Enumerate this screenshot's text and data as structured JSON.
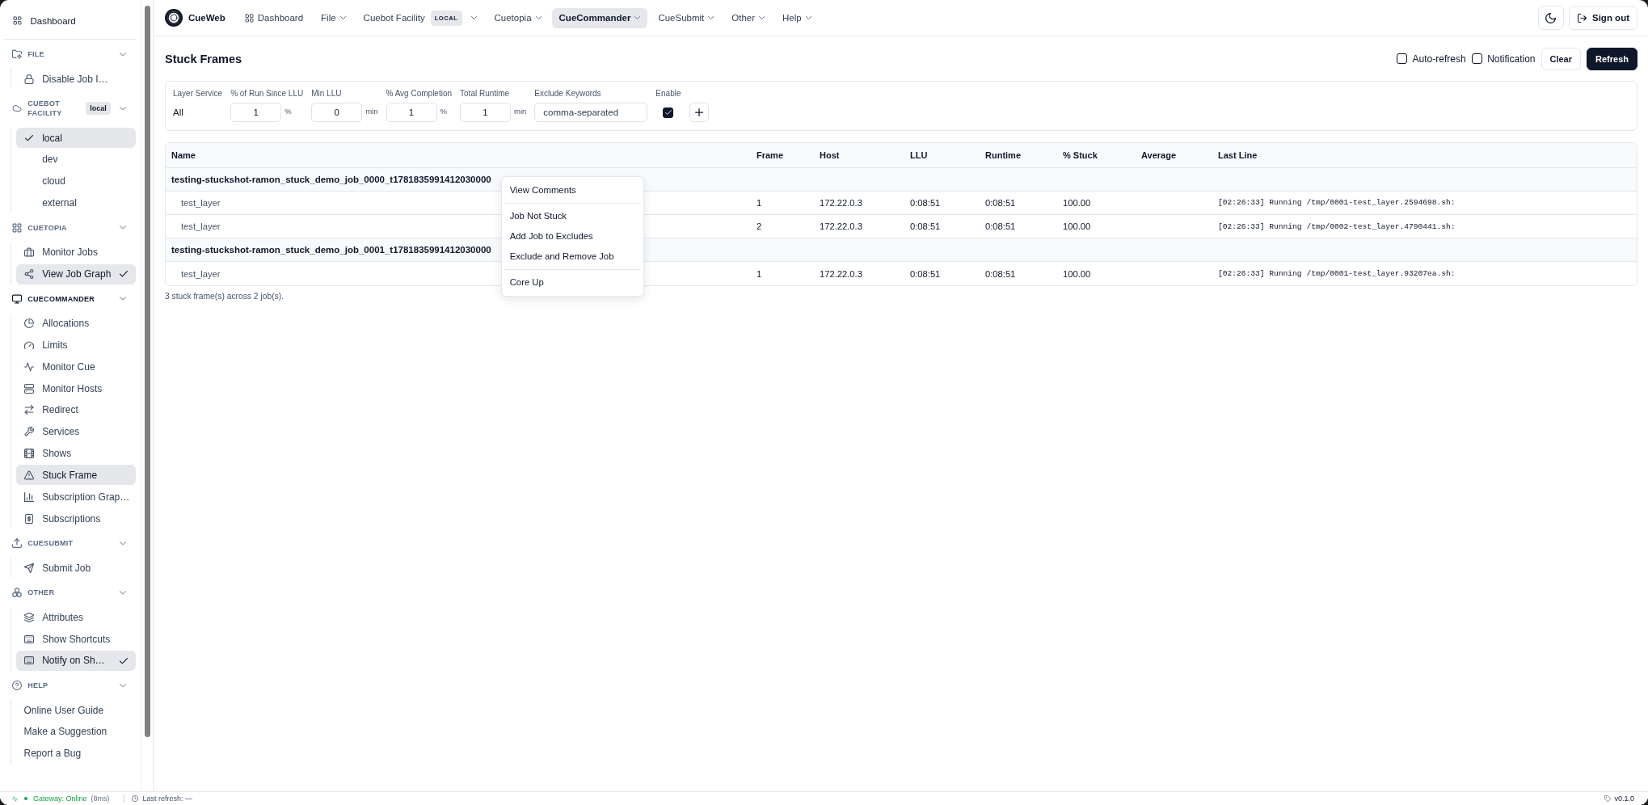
{
  "topbar": {
    "logo": "CueWeb",
    "nav": [
      {
        "label": "Dashboard",
        "kind": "link",
        "selected": false
      },
      {
        "label": "File",
        "kind": "menu",
        "selected": false
      },
      {
        "label": "Cuebot Facility",
        "kind": "menu",
        "badge": "LOCAL",
        "selected": false
      },
      {
        "label": "Cuetopia",
        "kind": "menu",
        "selected": false
      },
      {
        "label": "CueCommander",
        "kind": "menu",
        "selected": true
      },
      {
        "label": "CueSubmit",
        "kind": "menu",
        "selected": false
      },
      {
        "label": "Other",
        "kind": "menu",
        "selected": false
      },
      {
        "label": "Help",
        "kind": "menu",
        "selected": false
      }
    ],
    "sign_out": "Sign out"
  },
  "sidebar": {
    "dashboard": "Dashboard",
    "sections": [
      {
        "label": "FILE",
        "expanded": true,
        "active": false,
        "items": [
          {
            "label": "Disable Job I…",
            "selected": false,
            "checked": false
          }
        ]
      },
      {
        "label": "CUEBOT FACILITY",
        "badge": "local",
        "expanded": true,
        "active": false,
        "items": [
          {
            "label": "local",
            "selected": true,
            "checked": true
          },
          {
            "label": "dev",
            "selected": false,
            "checked": false
          },
          {
            "label": "cloud",
            "selected": false,
            "checked": false
          },
          {
            "label": "external",
            "selected": false,
            "checked": false
          }
        ]
      },
      {
        "label": "CUETOPIA",
        "expanded": true,
        "active": false,
        "items": [
          {
            "label": "Monitor Jobs",
            "selected": false,
            "checked": false
          },
          {
            "label": "View Job Graph",
            "selected": true,
            "checked": true
          }
        ]
      },
      {
        "label": "CUECOMMANDER",
        "expanded": true,
        "active": true,
        "items": [
          {
            "label": "Allocations",
            "selected": false,
            "checked": false
          },
          {
            "label": "Limits",
            "selected": false,
            "checked": false
          },
          {
            "label": "Monitor Cue",
            "selected": false,
            "checked": false
          },
          {
            "label": "Monitor Hosts",
            "selected": false,
            "checked": false
          },
          {
            "label": "Redirect",
            "selected": false,
            "checked": false
          },
          {
            "label": "Services",
            "selected": false,
            "checked": false
          },
          {
            "label": "Shows",
            "selected": false,
            "checked": false
          },
          {
            "label": "Stuck Frame",
            "selected": true,
            "checked": false
          },
          {
            "label": "Subscription Grap…",
            "selected": false,
            "checked": false
          },
          {
            "label": "Subscriptions",
            "selected": false,
            "checked": false
          }
        ]
      },
      {
        "label": "CUESUBMIT",
        "expanded": true,
        "active": false,
        "items": [
          {
            "label": "Submit Job",
            "selected": false,
            "checked": false
          }
        ]
      },
      {
        "label": "OTHER",
        "expanded": true,
        "active": false,
        "items": [
          {
            "label": "Attributes",
            "selected": false,
            "checked": false
          },
          {
            "label": "Show Shortcuts",
            "selected": false,
            "checked": false
          },
          {
            "label": "Notify on Sh…",
            "selected": true,
            "checked": true
          }
        ]
      },
      {
        "label": "HELP",
        "expanded": true,
        "active": false,
        "items": [
          {
            "label": "Online User Guide",
            "selected": false,
            "checked": false
          },
          {
            "label": "Make a Suggestion",
            "selected": false,
            "checked": false
          },
          {
            "label": "Report a Bug",
            "selected": false,
            "checked": false
          }
        ]
      }
    ]
  },
  "page": {
    "title": "Stuck Frames",
    "toggles": [
      {
        "label": "Auto-refresh",
        "checked": false
      },
      {
        "label": "Notification",
        "checked": false
      }
    ],
    "buttons": [
      {
        "label": "Clear",
        "kind": "outline"
      },
      {
        "label": "Refresh",
        "kind": "primary"
      }
    ]
  },
  "filters": [
    {
      "label": "Layer Service",
      "kind": "static",
      "value": "All"
    },
    {
      "label": "% of Run Since LLU",
      "kind": "number",
      "value": "1",
      "unit": "%"
    },
    {
      "label": "Min LLU",
      "kind": "number",
      "value": "0",
      "unit": "min"
    },
    {
      "label": "% Avg Completion",
      "kind": "number",
      "value": "1",
      "unit": "%"
    },
    {
      "label": "Total Runtime",
      "kind": "number",
      "value": "1",
      "unit": "min"
    },
    {
      "label": "Exclude Keywords",
      "kind": "text",
      "placeholder": "comma-separated"
    },
    {
      "label": "Enable",
      "kind": "checkbox",
      "checked": true
    }
  ],
  "table": {
    "columns": [
      "Name",
      "Frame",
      "Host",
      "LLU",
      "Runtime",
      "% Stuck",
      "Average",
      "Last Line"
    ],
    "jobs": [
      {
        "name": "testing-stuckshot-ramon_stuck_demo_job_0000_t1781835991412030000",
        "frames": [
          {
            "layer": "test_layer",
            "frame": "1",
            "host": "172.22.0.3",
            "llu": "0:08:51",
            "runtime": "0:08:51",
            "stuck": "100.00",
            "last_line": "[02:26:33] Running /tmp/0001-test_layer.2594698.sh:"
          },
          {
            "layer": "test_layer",
            "frame": "2",
            "host": "172.22.0.3",
            "llu": "0:08:51",
            "runtime": "0:08:51",
            "stuck": "100.00",
            "last_line": "[02:26:33] Running /tmp/0002-test_layer.4790441.sh:"
          }
        ]
      },
      {
        "name": "testing-stuckshot-ramon_stuck_demo_job_0001_t1781835991412030000",
        "frames": [
          {
            "layer": "test_layer",
            "frame": "1",
            "host": "172.22.0.3",
            "llu": "0:08:51",
            "runtime": "0:08:51",
            "stuck": "100.00",
            "last_line": "[02:26:33] Running /tmp/0001-test_layer.93207ea.sh:"
          }
        ]
      }
    ]
  },
  "summary": "3 stuck frame(s) across 2 job(s).",
  "context_menu": {
    "groups": [
      {
        "items": [
          "View Comments"
        ]
      },
      {
        "items": [
          "Job Not Stuck",
          "Add Job to Excludes",
          "Exclude and Remove Job"
        ]
      },
      {
        "items": [
          "Core Up"
        ]
      }
    ]
  },
  "status_bar": {
    "gateway": {
      "label": "Gateway: Online",
      "latency": "(8ms)",
      "online": true
    },
    "last_refresh": "Last refresh: —",
    "version": "v0.1.0"
  }
}
